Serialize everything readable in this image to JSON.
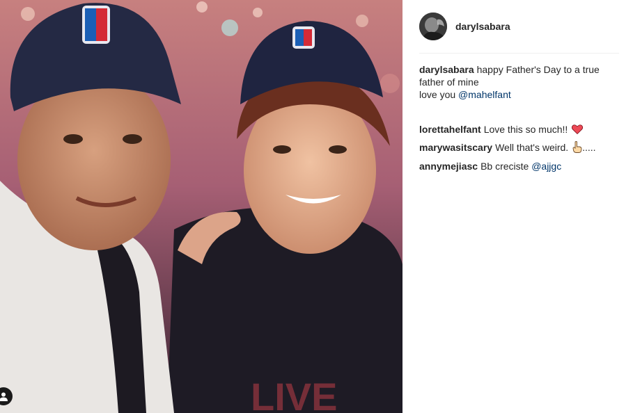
{
  "post": {
    "author": "darylsabara",
    "caption": {
      "username": "darylsabara",
      "line1": "happy Father's Day to a true father of mine",
      "line2_prefix": "love you ",
      "mention": "@mahelfant"
    },
    "comments": [
      {
        "username": "lorettahelfant",
        "text": "Love this so much!!",
        "emoji": "heart"
      },
      {
        "username": "marywasitscary",
        "text": "Well that's weird.",
        "emoji": "pointing-hand",
        "suffix": "....."
      },
      {
        "username": "annymejiasc",
        "text": "Bb creciste ",
        "mention": "@ajjgc"
      }
    ]
  },
  "photo": {
    "watermark": "LIVE"
  },
  "colors": {
    "text": "#262626",
    "mention": "#003569",
    "divider": "#efefef",
    "heart": "#ed4956"
  },
  "icons": {
    "tag": "user-tag-icon",
    "heart": "red-heart-emoji",
    "hand": "pointing-hand-emoji"
  }
}
